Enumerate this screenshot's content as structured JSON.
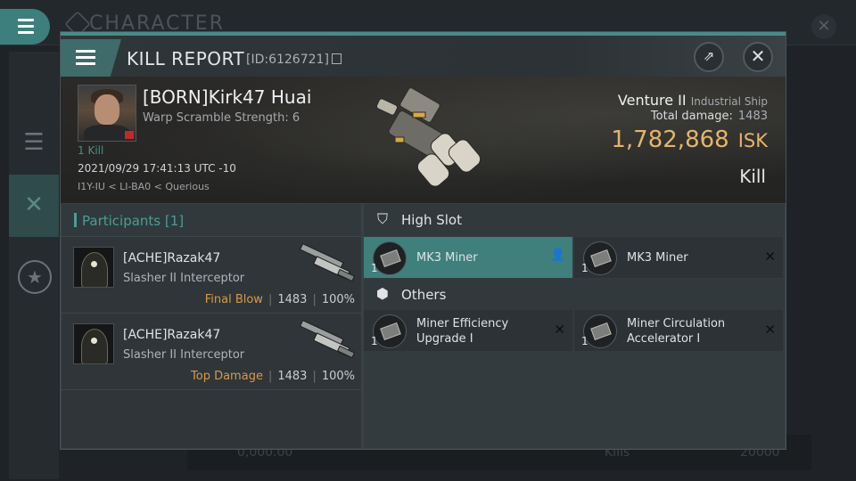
{
  "background": {
    "title": "CHARACTER",
    "close_icon": "close-icon",
    "footer": {
      "value_left": "0,000.00",
      "value_mid": "Kills",
      "value_right": "20000"
    }
  },
  "header": {
    "title": "KILL REPORT",
    "id": "[ID:6126721]",
    "share_icon": "share-icon",
    "close_icon": "close-icon"
  },
  "victim": {
    "name": "[BORN]Kirk47 Huai",
    "warp_scramble": "Warp Scramble Strength: 6",
    "kill_count": "1 Kill",
    "datetime": "2021/09/29 17:41:13 UTC -10",
    "location": "I1Y-IU < LI-BA0 < Querious"
  },
  "ship": {
    "name": "Venture II",
    "class": "Industrial Ship",
    "total_damage_label": "Total damage:",
    "total_damage": "1483",
    "isk_value": "1,782,868",
    "isk_unit": "ISK",
    "type": "Kill"
  },
  "participants": {
    "header": "Participants [1]",
    "items": [
      {
        "name": "[ACHE]Razak47",
        "ship": "Slasher II Interceptor",
        "tag": "Final Blow",
        "damage": "1483",
        "percent": "100%"
      },
      {
        "name": "[ACHE]Razak47",
        "ship": "Slasher II Interceptor",
        "tag": "Top Damage",
        "damage": "1483",
        "percent": "100%"
      }
    ]
  },
  "slots": {
    "high": {
      "label": "High Slot",
      "items": [
        {
          "qty": "1",
          "name": "MK3 Miner",
          "selected": true
        },
        {
          "qty": "1",
          "name": "MK3 Miner",
          "selected": false
        }
      ]
    },
    "others": {
      "label": "Others",
      "items": [
        {
          "qty": "1",
          "name": "Miner Efficiency Upgrade I"
        },
        {
          "qty": "1",
          "name": "Miner Circulation Accelerator I"
        }
      ]
    }
  },
  "colors": {
    "accent": "#3f7f7c",
    "isk": "#e6b46a",
    "tag": "#d79a45",
    "kill_count": "#4c8f86"
  }
}
